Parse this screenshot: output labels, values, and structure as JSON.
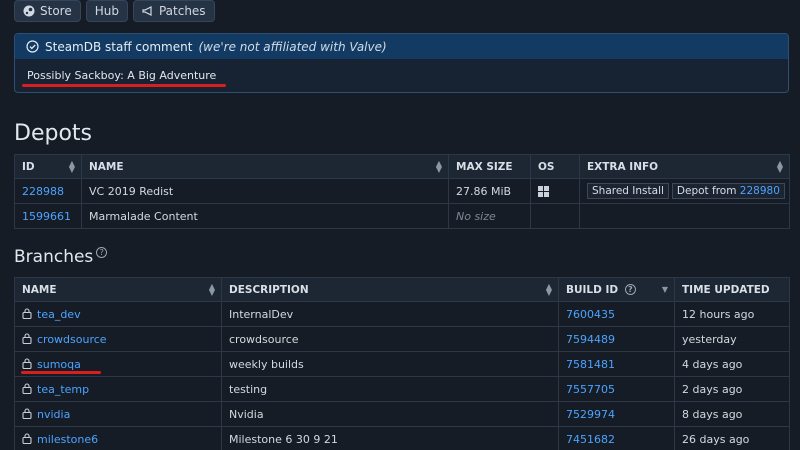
{
  "nav": {
    "store": "Store",
    "hub": "Hub",
    "patches": "Patches"
  },
  "staff_comment": {
    "title": "SteamDB staff comment",
    "note": "(we're not affiliated with Valve)",
    "body": "Possibly Sackboy: A Big Adventure"
  },
  "depots": {
    "heading": "Depots",
    "columns": [
      "ID",
      "NAME",
      "MAX SIZE",
      "OS",
      "EXTRA INFO"
    ],
    "rows": [
      {
        "id": "228988",
        "name": "VC 2019 Redist",
        "size": "27.86 MiB",
        "os": "windows-icon",
        "tag1": "Shared Install",
        "tag2_prefix": "Depot from",
        "tag2_link": "228980"
      },
      {
        "id": "1599661",
        "name": "Marmalade Content",
        "size": "No size",
        "os": "",
        "tag1": "",
        "tag2_prefix": "",
        "tag2_link": ""
      }
    ]
  },
  "branches": {
    "heading": "Branches",
    "columns": [
      "NAME",
      "DESCRIPTION",
      "BUILD ID",
      "TIME UPDATED"
    ],
    "rows": [
      {
        "name": "tea_dev",
        "description": "InternalDev",
        "build": "7600435",
        "time": "12 hours ago"
      },
      {
        "name": "crowdsource",
        "description": "crowdsource",
        "build": "7594489",
        "time": "yesterday"
      },
      {
        "name": "sumoqa",
        "description": "weekly builds",
        "build": "7581481",
        "time": "4 days ago"
      },
      {
        "name": "tea_temp",
        "description": "testing",
        "build": "7557705",
        "time": "2 days ago"
      },
      {
        "name": "nvidia",
        "description": "Nvidia",
        "build": "7529974",
        "time": "8 days ago"
      },
      {
        "name": "milestone6",
        "description": "Milestone 6 30 9 21",
        "build": "7451682",
        "time": "26 days ago"
      }
    ]
  },
  "colors": {
    "background": "#151c26",
    "link": "#4da3ff",
    "staff_header": "#123a63",
    "highlight_underline": "#d81e1e"
  }
}
